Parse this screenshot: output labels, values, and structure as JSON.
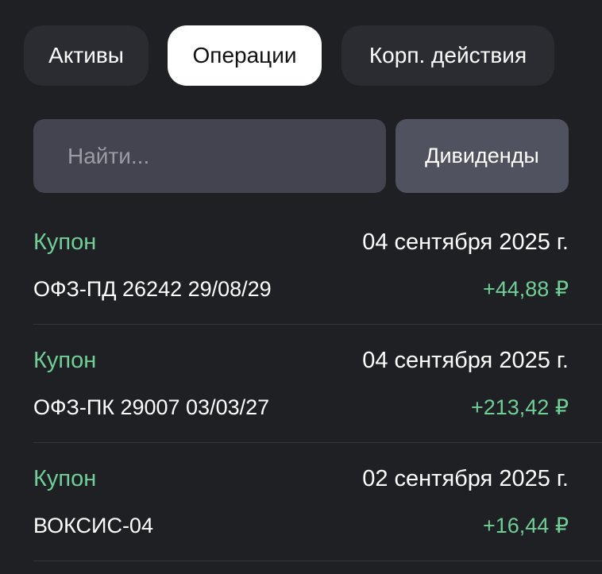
{
  "tabs": [
    {
      "label": "Активы",
      "active": false
    },
    {
      "label": "Операции",
      "active": true
    },
    {
      "label": "Корп. действия",
      "active": false
    }
  ],
  "search": {
    "placeholder": "Найти...",
    "value": ""
  },
  "filter": {
    "label": "Дивиденды"
  },
  "operations": [
    {
      "type": "Купон",
      "date": "04 сентября 2025 г.",
      "instrument": "ОФЗ-ПД 26242 29/08/29",
      "amount": "+44,88 ₽"
    },
    {
      "type": "Купон",
      "date": "04 сентября 2025 г.",
      "instrument": "ОФЗ-ПК 29007 03/03/27",
      "amount": "+213,42 ₽"
    },
    {
      "type": "Купон",
      "date": "02 сентября 2025 г.",
      "instrument": "ВОКСИС-04",
      "amount": "+16,44 ₽"
    }
  ],
  "colors": {
    "background": "#1f2023",
    "accent_green": "#6fcf97",
    "tab_active_bg": "#ffffff",
    "tab_inactive_bg": "#2b2c31"
  }
}
